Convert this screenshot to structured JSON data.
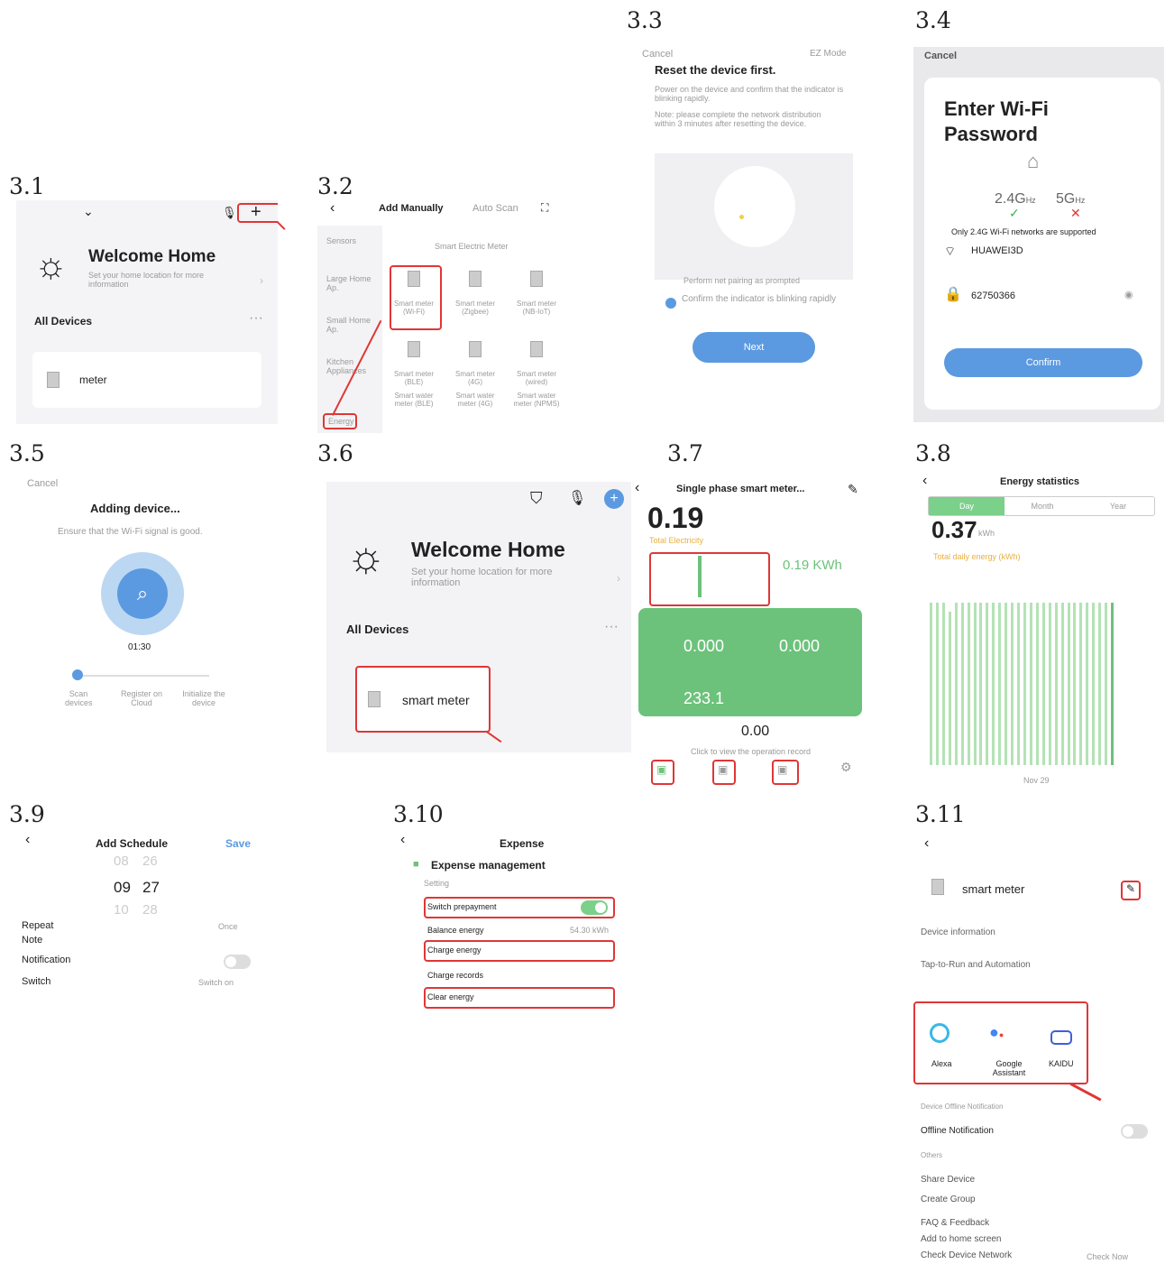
{
  "steps": {
    "s31": "3.1",
    "s32": "3.2",
    "s33": "3.3",
    "s34": "3.4",
    "s35": "3.5",
    "s36": "3.6",
    "s37": "3.7",
    "s38": "3.8",
    "s39": "3.9",
    "s310": "3.10",
    "s311": "3.11"
  },
  "p31": {
    "title": "Welcome Home",
    "subtitle": "Set your home location for more information",
    "all_devices": "All Devices",
    "device": "meter"
  },
  "p32": {
    "tab_manual": "Add Manually",
    "tab_auto": "Auto Scan",
    "category_head": "Smart Electric Meter",
    "sidebar": [
      "Sensors",
      "Large Home Ap.",
      "Small Home Ap.",
      "Kitchen Appliances",
      "Energy"
    ],
    "devices": [
      "Smart meter (Wi-Fi)",
      "Smart meter (Zigbee)",
      "Smart meter (NB-IoT)",
      "Smart meter (BLE)",
      "Smart meter (4G)",
      "Smart meter (wired)",
      "Smart water meter (BLE)",
      "Smart water meter (4G)",
      "Smart water meter (NPMS)"
    ]
  },
  "p33": {
    "cancel": "Cancel",
    "mode": "EZ Mode",
    "heading": "Reset the device first.",
    "desc1": "Power on the device and confirm that the indicator is blinking rapidly.",
    "desc2": "Note: please complete the network distribution within 3 minutes after resetting the device.",
    "prompt": "Perform net pairing as prompted",
    "confirm": "Confirm the indicator is blinking rapidly",
    "next": "Next"
  },
  "p34": {
    "cancel": "Cancel",
    "title_l1": "Enter Wi-Fi",
    "title_l2": "Password",
    "band24": "2.4G",
    "band5": "5G",
    "unit": "Hz",
    "note": "Only 2.4G Wi-Fi networks are supported",
    "ssid": "HUAWEI3D",
    "password": "62750366",
    "confirm": "Confirm"
  },
  "p35": {
    "cancel": "Cancel",
    "title": "Adding device...",
    "subtitle": "Ensure that the Wi-Fi signal is good.",
    "timer": "01:30",
    "steps": [
      "Scan devices",
      "Register on Cloud",
      "Initialize the device"
    ]
  },
  "p36": {
    "title": "Welcome Home",
    "subtitle": "Set your home location for more information",
    "all_devices": "All Devices",
    "device": "smart meter"
  },
  "p37": {
    "title": "Single phase smart meter...",
    "value": "0.19",
    "value_label": "Total Electricity",
    "kwh": "0.19 KWh",
    "left_val": "0.000",
    "right_val": "0.000",
    "voltage": "233.1",
    "bottom_val": "0.00",
    "bottom_label": "Click to view the operation record"
  },
  "p38": {
    "title": "Energy statistics",
    "tabs": [
      "Day",
      "Month",
      "Year"
    ],
    "value": "0.37",
    "unit": "kWh",
    "legend": "Total daily energy (kWh)",
    "xmid": "Nov 29",
    "bars": [
      0.9,
      0.9,
      0.9,
      0.85,
      0.9,
      0.9,
      0.9,
      0.9,
      0.9,
      0.9,
      0.9,
      0.9,
      0.9,
      0.9,
      0.9,
      0.9,
      0.9,
      0.9,
      0.9,
      0.9,
      0.9,
      0.9,
      0.9,
      0.9,
      0.9,
      0.9,
      0.9,
      0.9,
      0.9,
      0.9
    ]
  },
  "p39": {
    "title": "Add Schedule",
    "save": "Save",
    "h_prev": "08",
    "m_prev": "26",
    "h": "09",
    "m": "27",
    "h_next": "10",
    "m_next": "28",
    "repeat": "Repeat",
    "repeat_val": "Once",
    "note": "Note",
    "notification": "Notification",
    "switch": "Switch",
    "switch_val": "Switch on"
  },
  "p310": {
    "title": "Expense",
    "heading": "Expense management",
    "setting": "Setting",
    "rows": [
      "Switch prepayment",
      "Balance energy",
      "Charge energy",
      "Charge records",
      "Clear energy"
    ],
    "balance_val": "54.30 kWh"
  },
  "p311": {
    "device": "smart meter",
    "device_info": "Device information",
    "tap": "Tap-to-Run and Automation",
    "alexa": "Alexa",
    "google": "Google Assistant",
    "kaidu": "KAIDU",
    "offline_head": "Device Offline Notification",
    "offline": "Offline Notification",
    "others": "Others",
    "share": "Share Device",
    "group": "Create Group",
    "faq": "FAQ & Feedback",
    "home": "Add to home screen",
    "network": "Check Device Network",
    "check": "Check Now"
  }
}
